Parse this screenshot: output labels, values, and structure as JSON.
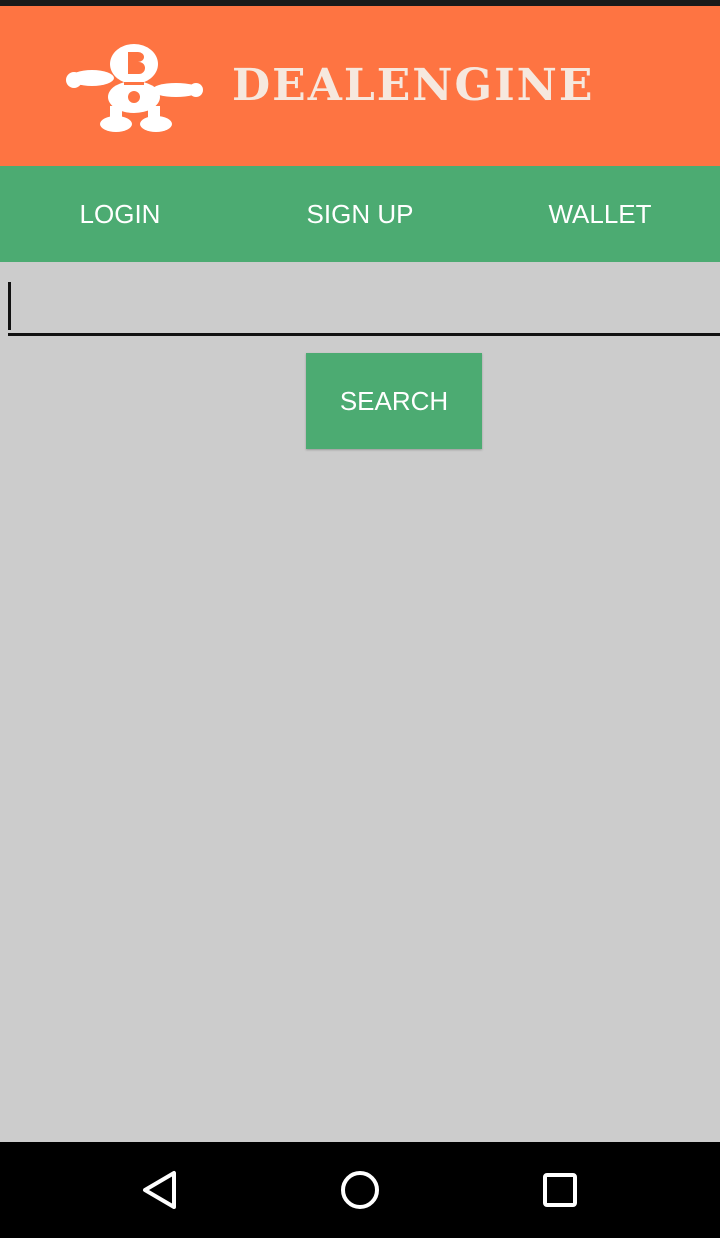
{
  "app": {
    "logo_text": "DEALENGINE",
    "logo_icon": "dealengine-mascot-icon"
  },
  "nav": {
    "items": [
      {
        "label": "LOGIN"
      },
      {
        "label": "SIGN UP"
      },
      {
        "label": "WALLET"
      }
    ]
  },
  "search": {
    "value": "",
    "placeholder": "",
    "button_label": "SEARCH"
  },
  "system_nav": {
    "back_icon": "back-triangle-icon",
    "home_icon": "home-circle-icon",
    "recents_icon": "recents-square-icon"
  },
  "colors": {
    "banner": "#fe7442",
    "accent_green": "#4cab72",
    "background": "#cccccc"
  }
}
